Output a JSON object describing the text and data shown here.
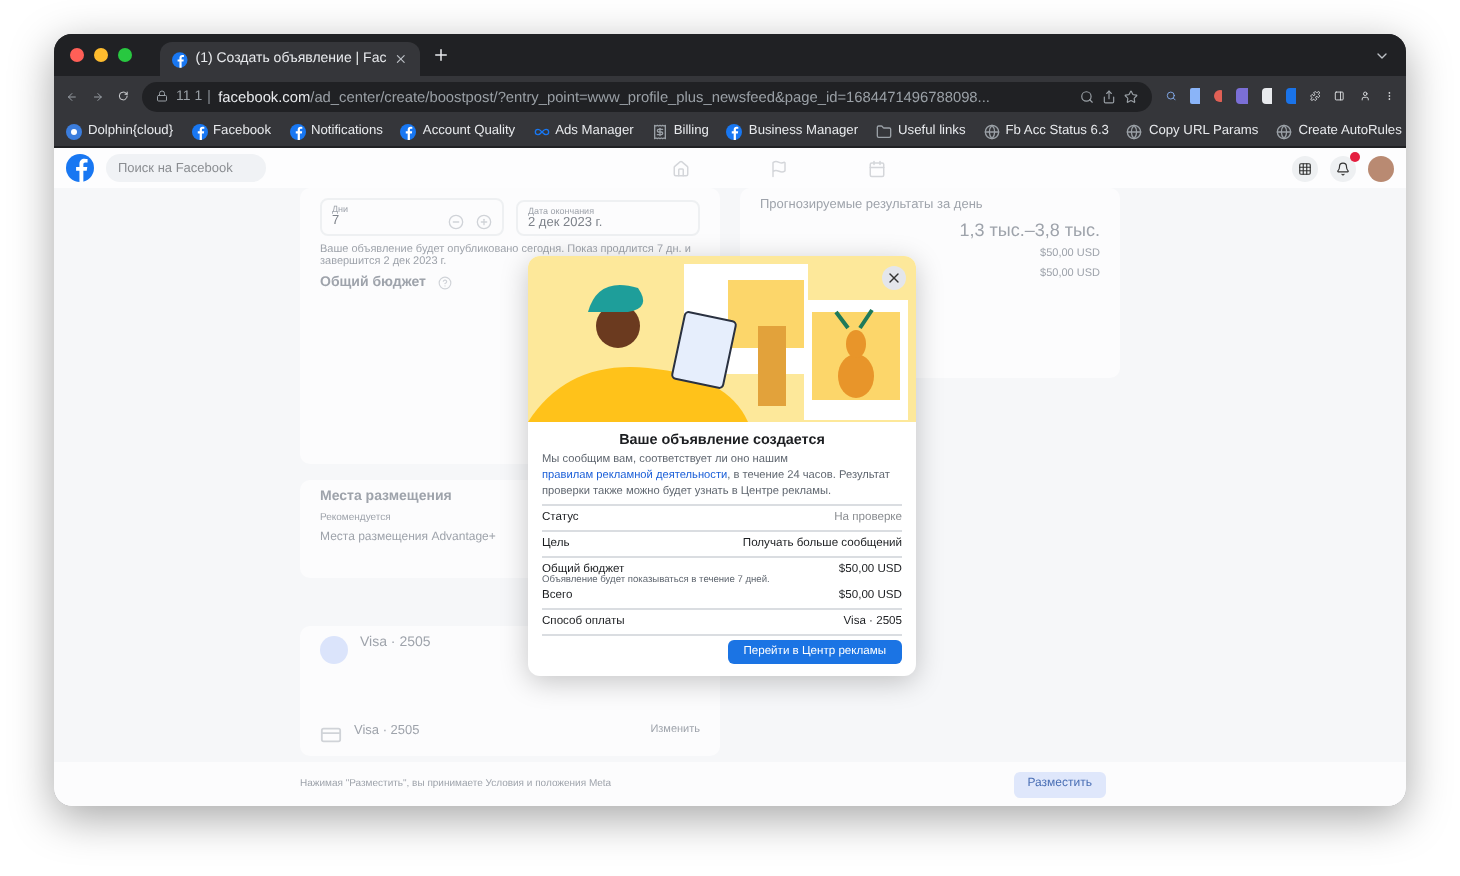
{
  "browser": {
    "tab": {
      "title": "(1) Создать объявление | Fac"
    },
    "address": {
      "prefix": "11 1",
      "domain": "facebook.com",
      "path": "/ad_center/create/boostpost/?entry_point=www_profile_plus_newsfeed&page_id=1684471496788098..."
    },
    "bookmarks": [
      {
        "label": "Dolphin{cloud}",
        "kind": "dolphin"
      },
      {
        "label": "Facebook",
        "kind": "fb"
      },
      {
        "label": "Notifications",
        "kind": "fb"
      },
      {
        "label": "Account Quality",
        "kind": "fb"
      },
      {
        "label": "Ads Manager",
        "kind": "meta"
      },
      {
        "label": "Billing",
        "kind": "billing"
      },
      {
        "label": "Business Manager",
        "kind": "fb"
      },
      {
        "label": "Useful links",
        "kind": "folder"
      },
      {
        "label": "Fb Acc Status 6.3",
        "kind": "globe"
      },
      {
        "label": "Copy URL Params",
        "kind": "globe"
      },
      {
        "label": "Create AutoRules",
        "kind": "globe"
      }
    ]
  },
  "fb_header": {
    "search": {
      "placeholder": "Поиск на Facebook"
    },
    "notifications": {
      "unread": true
    }
  },
  "form": {
    "duration": {
      "label": "Дни",
      "value": "7"
    },
    "end_date": {
      "label": "Дата окончания",
      "value": "2 дек 2023 г."
    },
    "schedule_note": "Ваше объявление будет опубликовано сегодня. Показ продлится 7 дн. и завершится 2 дек 2023 г.",
    "budget_title": "Общий бюджет",
    "placements": {
      "title": "Места размещения",
      "caption": "Рекомендуется",
      "value": "Места размещения Advantage+"
    },
    "payment": {
      "method": "Visa · 2505",
      "card": "Visa · 2505",
      "edit": "Изменить"
    }
  },
  "forecast": {
    "title": "Прогнозируемые результаты за день",
    "value": "1,3 тыс.–3,8 тыс.",
    "amounts": [
      "$50,00 USD",
      "$50,00 USD"
    ]
  },
  "footer": {
    "terms": "Нажимая \"Разместить\", вы принимаете Условия и положения Meta",
    "submit": "Разместить"
  },
  "modal": {
    "title": "Ваше объявление создается",
    "intro": {
      "before": "Мы сообщим вам, соответствует ли оно нашим ",
      "link": "правилам рекламной деятельности",
      "after": ", в течение 24 часов. Результат проверки также можно будет узнать в Центре рекламы."
    },
    "groups": [
      {
        "rows": [
          {
            "label": "Статус",
            "value": "На проверке",
            "muted": true
          }
        ]
      },
      {
        "rows": [
          {
            "label": "Цель",
            "value": "Получать больше сообщений",
            "muted": false
          }
        ]
      },
      {
        "rows": [
          {
            "label": "Общий бюджет",
            "value": "$50,00 USD",
            "muted": false,
            "note": "Объявление будет показываться в течение 7 дней."
          },
          {
            "label": "Всего",
            "value": "$50,00 USD",
            "muted": false
          }
        ]
      },
      {
        "rows": [
          {
            "label": "Способ оплаты",
            "value": "Visa · 2505",
            "muted": false
          }
        ]
      }
    ],
    "button": "Перейти в Центр рекламы"
  }
}
